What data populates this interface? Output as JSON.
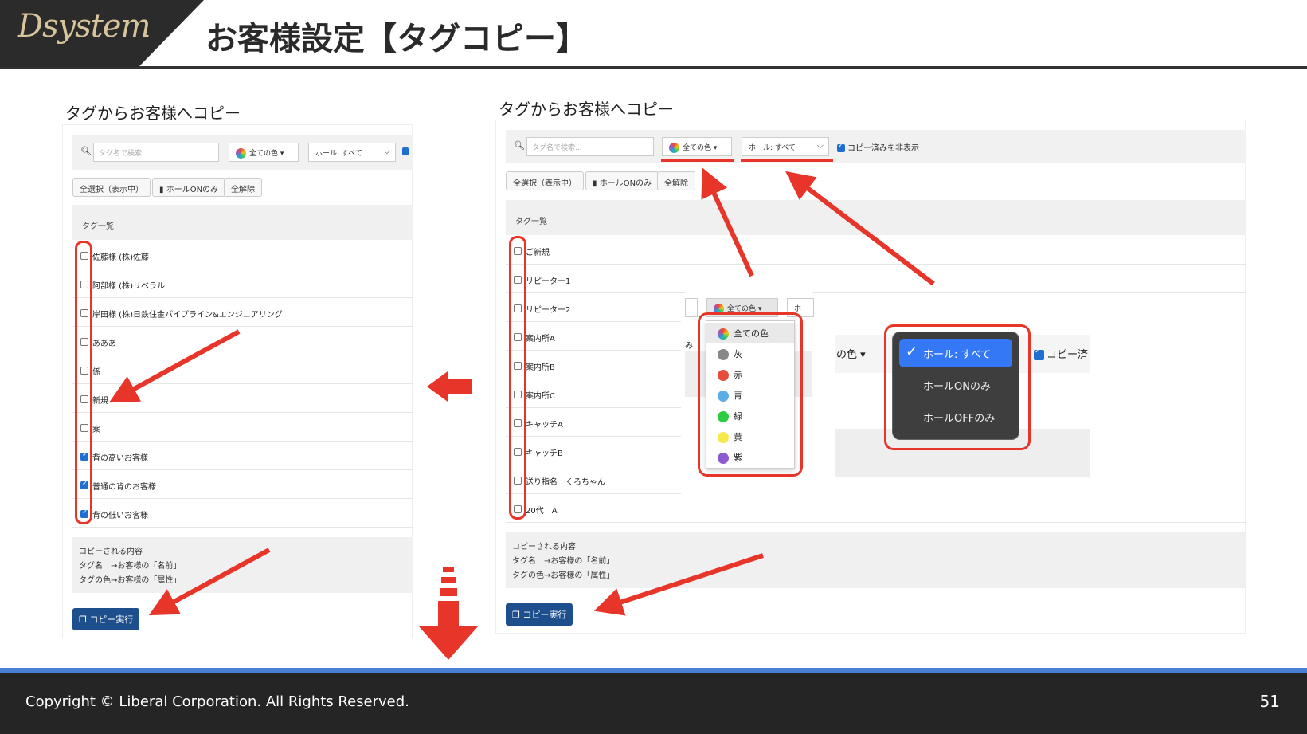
{
  "logo": "Dsystem",
  "title": "お客様設定【タグコピー】",
  "footer": {
    "copyright": "Copyright ©  Liberal Corporation. All Rights Reserved.",
    "page": "51"
  },
  "left": {
    "title": "タグからお客様へコピー",
    "search_placeholder": "タグ名で検索...",
    "color_select": "全ての色",
    "hall_select": "ホール: すべて",
    "btn_select_all": "全選択（表示中）",
    "btn_hall_on": "ホールONのみ",
    "btn_clear": "全解除",
    "list_header": "タグ一覧",
    "rows": [
      {
        "label": "佐藤様 (株)佐藤"
      },
      {
        "label": "阿部様 (株)リベラル"
      },
      {
        "label": "岸田様 (株)日鉄住金パイプライン&エンジニアリング"
      },
      {
        "label": "あああ"
      },
      {
        "label": "係"
      },
      {
        "label": "新規"
      },
      {
        "label": "案"
      },
      {
        "label": "背の高いお客様"
      },
      {
        "label": "普通の背のお客様"
      },
      {
        "label": "背の低いお客様"
      }
    ],
    "info_title": "コピーされる内容",
    "info_line1": "タグ名　→お客様の「名前」",
    "info_line2": "タグの色→お客様の「属性」",
    "copy_button": "コピー実行"
  },
  "right": {
    "title": "タグからお客様へコピー",
    "search_placeholder": "タグ名で検索...",
    "color_select": "全ての色",
    "hall_select": "ホール: すべて",
    "hide_copied": "コピー済みを非表示",
    "btn_select_all": "全選択（表示中）",
    "btn_hall_on": "ホールONのみ",
    "btn_clear": "全解除",
    "list_header": "タグ一覧",
    "rows": [
      {
        "label": "ご新規"
      },
      {
        "label": "リピーター1"
      },
      {
        "label": "リピーター2"
      },
      {
        "label": "案内所A"
      },
      {
        "label": "案内所B"
      },
      {
        "label": "案内所C"
      },
      {
        "label": "キャッチA"
      },
      {
        "label": "キャッチB"
      },
      {
        "label": "送り指名　くろちゃん"
      },
      {
        "label": "20代　A"
      }
    ],
    "info_title": "コピーされる内容",
    "info_line1": "タグ名　→お客様の「名前」",
    "info_line2": "タグの色→お客様の「属性」",
    "copy_button": "コピー実行"
  },
  "color_menu": {
    "trigger": "全ての色",
    "trigger_hall": "ホー",
    "frag_label": "み",
    "items": [
      {
        "label": "全ての色",
        "color": ""
      },
      {
        "label": "灰",
        "color": "#888888"
      },
      {
        "label": "赤",
        "color": "#e74c3c"
      },
      {
        "label": "青",
        "color": "#5dade2"
      },
      {
        "label": "緑",
        "color": "#2ecc40"
      },
      {
        "label": "黄",
        "color": "#f7e94c"
      },
      {
        "label": "紫",
        "color": "#8e5bd0"
      }
    ]
  },
  "hall_menu": {
    "bg_color_label": "の色",
    "bg_copy_label": "コピー済",
    "items": [
      {
        "label": "ホール: すべて"
      },
      {
        "label": "ホールONのみ"
      },
      {
        "label": "ホールOFFのみ"
      }
    ]
  },
  "colors": {
    "accent_red": "#e8352a",
    "primary_blue": "#1d4f8c",
    "footer_bar": "#4a7fd6"
  }
}
